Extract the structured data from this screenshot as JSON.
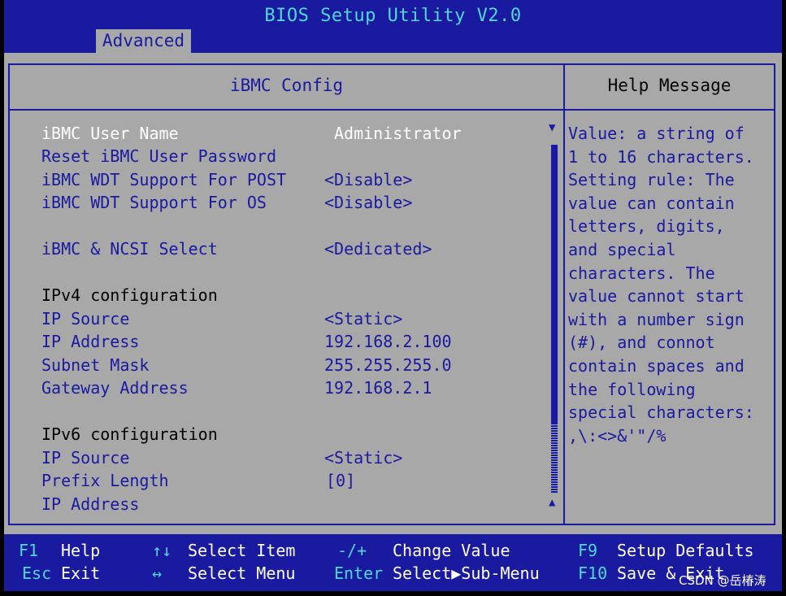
{
  "app": {
    "title": "BIOS Setup Utility V2.0",
    "tab": "Advanced"
  },
  "panel": {
    "title": "iBMC Config",
    "rows": [
      {
        "label": "iBMC User Name",
        "value": "Administrator"
      },
      {
        "label": "Reset iBMC User Password",
        "value": ""
      },
      {
        "label": "iBMC WDT Support For POST",
        "value": "<Disable>"
      },
      {
        "label": "iBMC WDT Support For OS",
        "value": "<Disable>"
      },
      {
        "label": "iBMC & NCSI Select",
        "value": "<Dedicated>"
      },
      {
        "label": "IPv4 configuration",
        "value": ""
      },
      {
        "label": "IP Source",
        "value": "<Static>"
      },
      {
        "label": "IP Address",
        "value": "192.168.2.100"
      },
      {
        "label": "Subnet Mask",
        "value": "255.255.255.0"
      },
      {
        "label": "Gateway Address",
        "value": "192.168.2.1"
      },
      {
        "label": "IPv6 configuration",
        "value": ""
      },
      {
        "label": "IP Source",
        "value": "<Static>"
      },
      {
        "label": "Prefix Length",
        "value": "[0]"
      },
      {
        "label": "IP Address",
        "value": ""
      }
    ]
  },
  "help": {
    "title": "Help Message",
    "text": "Value: a string of\n1 to 16 characters.\nSetting rule: The\nvalue can contain\nletters, digits,\nand special\ncharacters. The\nvalue cannot start\nwith a number sign\n(#), and connot\ncontain spaces and\nthe following\nspecial characters:\n,\\:<>&'\"/%"
  },
  "footer": {
    "f1_key": "F1",
    "f1_desc": "Help",
    "esc_key": "Esc",
    "esc_desc": "Exit",
    "updown_key": "↑↓",
    "updown_desc": "Select Item",
    "leftright_key": "↔",
    "leftright_desc": "Select Menu",
    "change_key": "-/+",
    "change_desc": "Change Value",
    "enter_key": "Enter",
    "enter_desc": "Select▶Sub-Menu",
    "f9_key": "F9",
    "f9_desc": "Setup Defaults",
    "f10_key": "F10",
    "f10_desc": "Save & Exit"
  },
  "watermark": "CSDN @岳椿涛",
  "colors": {
    "blue": "#1a1aa0",
    "gray": "#a8a8a8",
    "cyan": "#4fd8d8",
    "white": "#ffffff"
  }
}
